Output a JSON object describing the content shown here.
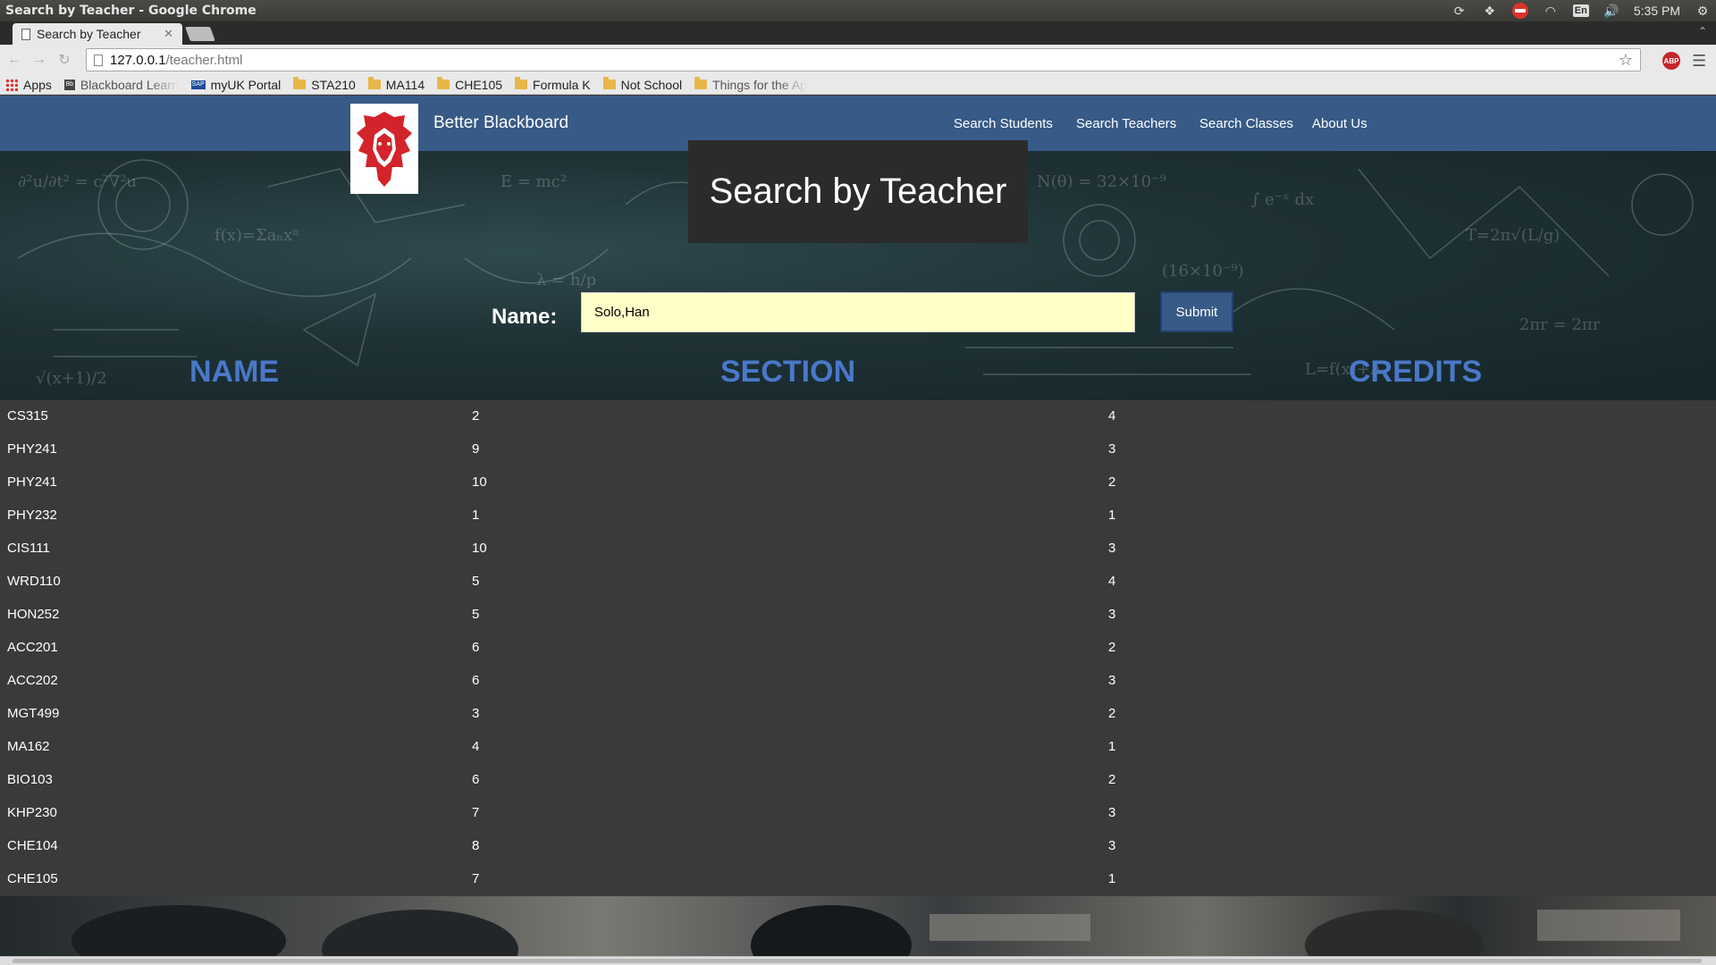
{
  "window": {
    "title": "Search by Teacher - Google Chrome"
  },
  "tray": {
    "lang": "En",
    "time": "5:35 PM"
  },
  "tab": {
    "title": "Search by Teacher"
  },
  "address": {
    "host": "127.0.0.1",
    "path": "/teacher.html"
  },
  "bookmarks": [
    "Apps",
    "Blackboard Learn",
    "myUK Portal",
    "STA210",
    "MA114",
    "CHE105",
    "Formula K",
    "Not School",
    "Things for the Ap"
  ],
  "site": {
    "brand": "Better Blackboard",
    "nav": [
      "Search Students",
      "Search Teachers",
      "Search Classes",
      "About Us"
    ]
  },
  "search": {
    "heading": "Search by Teacher",
    "name_label": "Name:",
    "name_value": "Solo,Han",
    "submit_label": "Submit"
  },
  "table": {
    "headers": [
      "NAME",
      "SECTION",
      "CREDITS"
    ],
    "rows": [
      [
        "CS315",
        "2",
        "4"
      ],
      [
        "PHY241",
        "9",
        "3"
      ],
      [
        "PHY241",
        "10",
        "2"
      ],
      [
        "PHY232",
        "1",
        "1"
      ],
      [
        "CIS111",
        "10",
        "3"
      ],
      [
        "WRD110",
        "5",
        "4"
      ],
      [
        "HON252",
        "5",
        "3"
      ],
      [
        "ACC201",
        "6",
        "2"
      ],
      [
        "ACC202",
        "6",
        "3"
      ],
      [
        "MGT499",
        "3",
        "2"
      ],
      [
        "MA162",
        "4",
        "1"
      ],
      [
        "BIO103",
        "6",
        "2"
      ],
      [
        "KHP230",
        "7",
        "3"
      ],
      [
        "CHE104",
        "8",
        "3"
      ],
      [
        "CHE105",
        "7",
        "1"
      ]
    ]
  },
  "colors": {
    "navbar": "#375a87",
    "header_text": "#4a78c9",
    "input_bg": "#ffffc8",
    "table_bg": "#3a3a3a"
  }
}
